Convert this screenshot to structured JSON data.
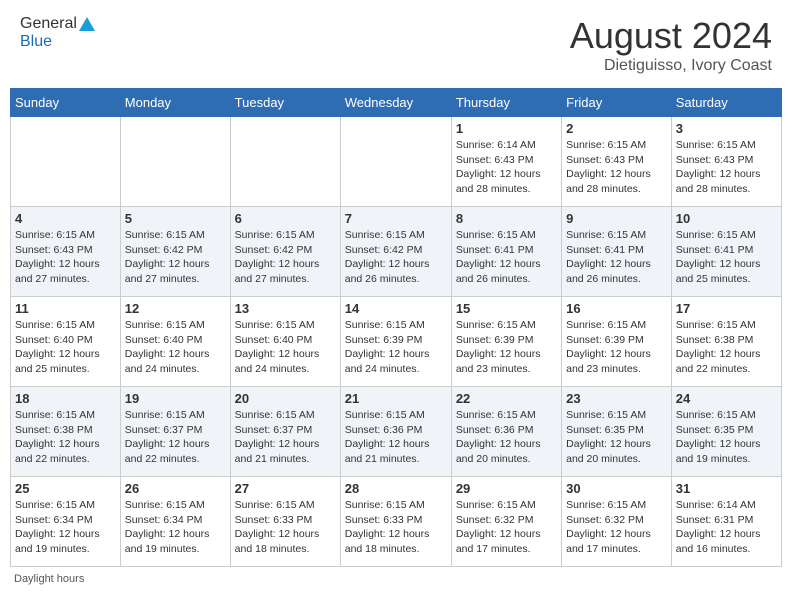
{
  "header": {
    "logo_general": "General",
    "logo_blue": "Blue",
    "month_title": "August 2024",
    "location": "Dietiguisso, Ivory Coast"
  },
  "days_of_week": [
    "Sunday",
    "Monday",
    "Tuesday",
    "Wednesday",
    "Thursday",
    "Friday",
    "Saturday"
  ],
  "footer": {
    "daylight_label": "Daylight hours"
  },
  "weeks": [
    [
      {
        "day": "",
        "sunrise": "",
        "sunset": "",
        "daylight": ""
      },
      {
        "day": "",
        "sunrise": "",
        "sunset": "",
        "daylight": ""
      },
      {
        "day": "",
        "sunrise": "",
        "sunset": "",
        "daylight": ""
      },
      {
        "day": "",
        "sunrise": "",
        "sunset": "",
        "daylight": ""
      },
      {
        "day": "1",
        "sunrise": "6:14 AM",
        "sunset": "6:43 PM",
        "daylight": "12 hours and 28 minutes."
      },
      {
        "day": "2",
        "sunrise": "6:15 AM",
        "sunset": "6:43 PM",
        "daylight": "12 hours and 28 minutes."
      },
      {
        "day": "3",
        "sunrise": "6:15 AM",
        "sunset": "6:43 PM",
        "daylight": "12 hours and 28 minutes."
      }
    ],
    [
      {
        "day": "4",
        "sunrise": "6:15 AM",
        "sunset": "6:43 PM",
        "daylight": "12 hours and 27 minutes."
      },
      {
        "day": "5",
        "sunrise": "6:15 AM",
        "sunset": "6:42 PM",
        "daylight": "12 hours and 27 minutes."
      },
      {
        "day": "6",
        "sunrise": "6:15 AM",
        "sunset": "6:42 PM",
        "daylight": "12 hours and 27 minutes."
      },
      {
        "day": "7",
        "sunrise": "6:15 AM",
        "sunset": "6:42 PM",
        "daylight": "12 hours and 26 minutes."
      },
      {
        "day": "8",
        "sunrise": "6:15 AM",
        "sunset": "6:41 PM",
        "daylight": "12 hours and 26 minutes."
      },
      {
        "day": "9",
        "sunrise": "6:15 AM",
        "sunset": "6:41 PM",
        "daylight": "12 hours and 26 minutes."
      },
      {
        "day": "10",
        "sunrise": "6:15 AM",
        "sunset": "6:41 PM",
        "daylight": "12 hours and 25 minutes."
      }
    ],
    [
      {
        "day": "11",
        "sunrise": "6:15 AM",
        "sunset": "6:40 PM",
        "daylight": "12 hours and 25 minutes."
      },
      {
        "day": "12",
        "sunrise": "6:15 AM",
        "sunset": "6:40 PM",
        "daylight": "12 hours and 24 minutes."
      },
      {
        "day": "13",
        "sunrise": "6:15 AM",
        "sunset": "6:40 PM",
        "daylight": "12 hours and 24 minutes."
      },
      {
        "day": "14",
        "sunrise": "6:15 AM",
        "sunset": "6:39 PM",
        "daylight": "12 hours and 24 minutes."
      },
      {
        "day": "15",
        "sunrise": "6:15 AM",
        "sunset": "6:39 PM",
        "daylight": "12 hours and 23 minutes."
      },
      {
        "day": "16",
        "sunrise": "6:15 AM",
        "sunset": "6:39 PM",
        "daylight": "12 hours and 23 minutes."
      },
      {
        "day": "17",
        "sunrise": "6:15 AM",
        "sunset": "6:38 PM",
        "daylight": "12 hours and 22 minutes."
      }
    ],
    [
      {
        "day": "18",
        "sunrise": "6:15 AM",
        "sunset": "6:38 PM",
        "daylight": "12 hours and 22 minutes."
      },
      {
        "day": "19",
        "sunrise": "6:15 AM",
        "sunset": "6:37 PM",
        "daylight": "12 hours and 22 minutes."
      },
      {
        "day": "20",
        "sunrise": "6:15 AM",
        "sunset": "6:37 PM",
        "daylight": "12 hours and 21 minutes."
      },
      {
        "day": "21",
        "sunrise": "6:15 AM",
        "sunset": "6:36 PM",
        "daylight": "12 hours and 21 minutes."
      },
      {
        "day": "22",
        "sunrise": "6:15 AM",
        "sunset": "6:36 PM",
        "daylight": "12 hours and 20 minutes."
      },
      {
        "day": "23",
        "sunrise": "6:15 AM",
        "sunset": "6:35 PM",
        "daylight": "12 hours and 20 minutes."
      },
      {
        "day": "24",
        "sunrise": "6:15 AM",
        "sunset": "6:35 PM",
        "daylight": "12 hours and 19 minutes."
      }
    ],
    [
      {
        "day": "25",
        "sunrise": "6:15 AM",
        "sunset": "6:34 PM",
        "daylight": "12 hours and 19 minutes."
      },
      {
        "day": "26",
        "sunrise": "6:15 AM",
        "sunset": "6:34 PM",
        "daylight": "12 hours and 19 minutes."
      },
      {
        "day": "27",
        "sunrise": "6:15 AM",
        "sunset": "6:33 PM",
        "daylight": "12 hours and 18 minutes."
      },
      {
        "day": "28",
        "sunrise": "6:15 AM",
        "sunset": "6:33 PM",
        "daylight": "12 hours and 18 minutes."
      },
      {
        "day": "29",
        "sunrise": "6:15 AM",
        "sunset": "6:32 PM",
        "daylight": "12 hours and 17 minutes."
      },
      {
        "day": "30",
        "sunrise": "6:15 AM",
        "sunset": "6:32 PM",
        "daylight": "12 hours and 17 minutes."
      },
      {
        "day": "31",
        "sunrise": "6:14 AM",
        "sunset": "6:31 PM",
        "daylight": "12 hours and 16 minutes."
      }
    ]
  ]
}
